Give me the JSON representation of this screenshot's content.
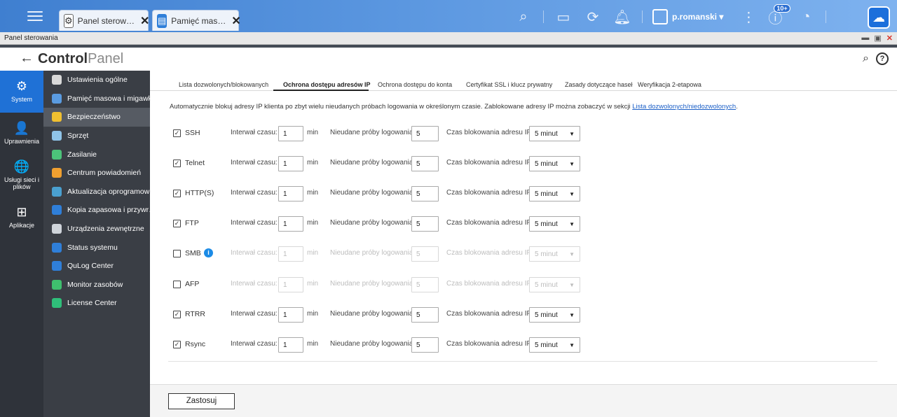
{
  "topbar": {
    "tabs": [
      {
        "label": "Panel sterow…"
      },
      {
        "label": "Pamięć mas…"
      }
    ],
    "user": "p.romanski ▾",
    "notification_badge": "10+"
  },
  "window": {
    "title": "Panel sterowania",
    "controls": {
      "minimize": "▬",
      "restore": "▣",
      "close": "✕"
    }
  },
  "header": {
    "back": "←",
    "title_bold": "Control",
    "title_light": "Panel"
  },
  "left_nav": [
    {
      "label": "System",
      "icon": "⚙",
      "active": true
    },
    {
      "label": "Uprawnienia",
      "icon": "👤",
      "active": false
    },
    {
      "label": "Usługi sieci i plików",
      "icon": "🌐",
      "active": false
    },
    {
      "label": "Aplikacje",
      "icon": "⊞",
      "active": false
    }
  ],
  "sub_nav": [
    {
      "label": "Ustawienia ogólne",
      "color": "#d8d8d8"
    },
    {
      "label": "Pamięć masowa i migawki",
      "color": "#5a9be0"
    },
    {
      "label": "Bezpieczeństwo",
      "color": "#f0c030"
    },
    {
      "label": "Sprzęt",
      "color": "#8fc3e8"
    },
    {
      "label": "Zasilanie",
      "color": "#4cc37a"
    },
    {
      "label": "Centrum powiadomień",
      "color": "#f0a030"
    },
    {
      "label": "Aktualizacja oprogramow…",
      "color": "#4aa0d0"
    },
    {
      "label": "Kopia zapasowa i przywr…",
      "color": "#2f7fd9"
    },
    {
      "label": "Urządzenia zewnętrzne",
      "color": "#cfd4da"
    },
    {
      "label": "Status systemu",
      "color": "#2f7fd9"
    },
    {
      "label": "QuLog Center",
      "color": "#2f7fd9"
    },
    {
      "label": "Monitor zasobów",
      "color": "#3fbf6e"
    },
    {
      "label": "License Center",
      "color": "#2fbf7a"
    }
  ],
  "tabs": [
    {
      "label": "Lista dozwolonych/blokowanych",
      "active": false
    },
    {
      "label": "Ochrona dostępu adresów IP",
      "active": true
    },
    {
      "label": "Ochrona dostępu do konta",
      "active": false
    },
    {
      "label": "Certyfikat SSL i klucz prywatny",
      "active": false
    },
    {
      "label": "Zasady dotyczące haseł",
      "active": false
    },
    {
      "label": "Weryfikacja 2-etapowa",
      "active": false
    }
  ],
  "description": {
    "text": "Automatycznie blokuj adresy IP klienta po zbyt wielu nieudanych próbach logowania w określonym czasie. Zablokowane adresy IP można zobaczyć w sekcji ",
    "link": "Lista dozwolonych/niedozwolonych",
    "suffix": "."
  },
  "labels": {
    "interval": "Interwał czasu:",
    "unit": "min",
    "failed": "Nieudane próby logowania:",
    "block": "Czas blokowania adresu IP:"
  },
  "services": [
    {
      "name": "SSH",
      "checked": true,
      "interval": "1",
      "attempts": "5",
      "block": "5 minut"
    },
    {
      "name": "Telnet",
      "checked": true,
      "interval": "1",
      "attempts": "5",
      "block": "5 minut"
    },
    {
      "name": "HTTP(S)",
      "checked": true,
      "interval": "1",
      "attempts": "5",
      "block": "5 minut"
    },
    {
      "name": "FTP",
      "checked": true,
      "interval": "1",
      "attempts": "5",
      "block": "5 minut"
    },
    {
      "name": "SMB",
      "checked": false,
      "info": true,
      "interval": "1",
      "attempts": "5",
      "block": "5 minut"
    },
    {
      "name": "AFP",
      "checked": false,
      "interval": "1",
      "attempts": "5",
      "block": "5 minut"
    },
    {
      "name": "RTRR",
      "checked": true,
      "interval": "1",
      "attempts": "5",
      "block": "5 minut"
    },
    {
      "name": "Rsync",
      "checked": true,
      "interval": "1",
      "attempts": "5",
      "block": "5 minut"
    }
  ],
  "footer": {
    "apply": "Zastosuj"
  }
}
